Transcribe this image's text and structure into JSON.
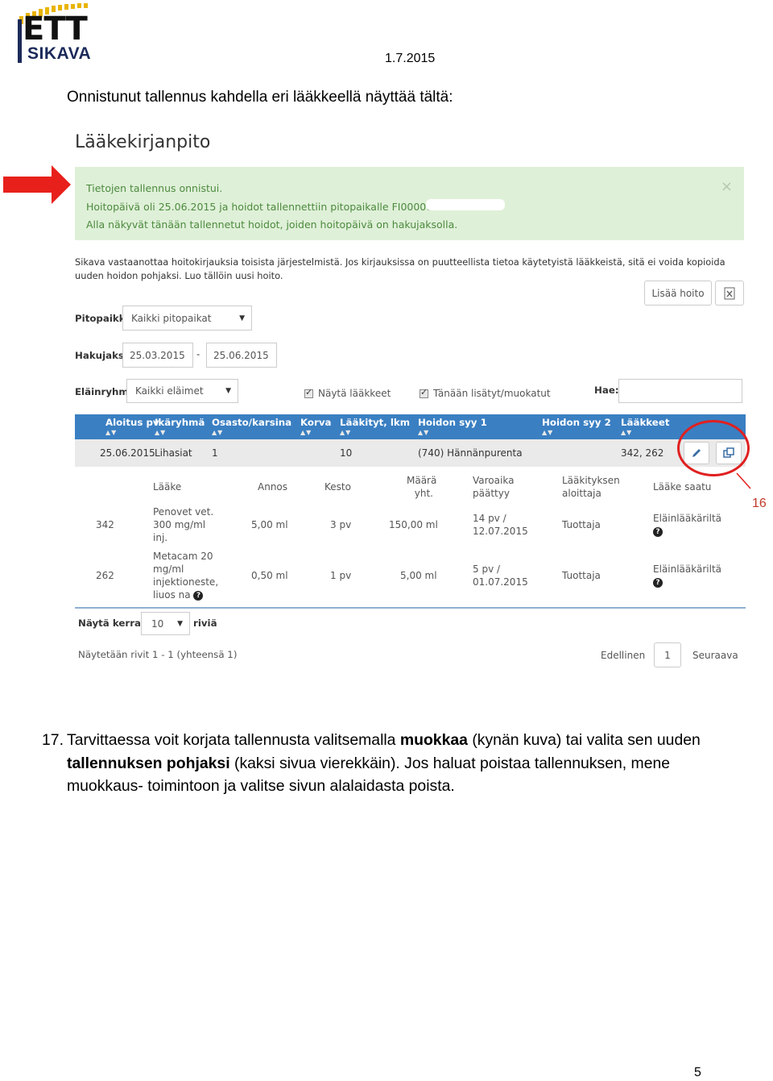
{
  "header": {
    "logo_text_top": "ETT",
    "logo_text_bottom": "SIKAVA",
    "date": "1.7.2015"
  },
  "intro": "Onnistunut tallennus kahdella eri lääkkeellä näyttää tältä:",
  "app": {
    "title": "Lääkekirjanpito",
    "alert": {
      "line1": "Tietojen tallennus onnistui.",
      "line2": "Hoitopäivä oli 25.06.2015 ja hoidot tallennettiin pitopaikalle FI00000",
      "line3": "Alla näkyvät tänään tallennetut hoidot, joiden hoitopäivä on hakujaksolla.",
      "close": "×"
    },
    "info": "Sikava vastaanottaa hoitokirjauksia toisista järjestelmistä. Jos kirjauksissa on puutteellista tietoa käytetyistä lääkkeistä, sitä ei voida kopioida uuden hoidon pohjaksi. Luo tällöin uusi hoito.",
    "add_button": "Lisää hoito",
    "filters": {
      "pitopaikka_label": "Pitopaikka",
      "pitopaikka_value": "Kaikki pitopaikat",
      "hakujakso_label": "Hakujakso",
      "date_from": "25.03.2015",
      "date_sep": "-",
      "date_to": "25.06.2015",
      "elainryhma_label": "Eläinryhmä",
      "elainryhma_value": "Kaikki eläimet",
      "check1": "Näytä lääkkeet",
      "check2": "Tänään lisätyt/muokatut",
      "search_label": "Hae:"
    },
    "table": {
      "headers": [
        "Aloitus pv",
        "Ikäryhmä",
        "Osasto/karsina",
        "Korva",
        "Lääkityt, lkm",
        "Hoidon syy 1",
        "Hoidon syy 2",
        "Lääkkeet"
      ],
      "sort_glyph": "▲▼",
      "row": {
        "aloitus": "25.06.2015",
        "ikaryhma": "Lihasiat",
        "osasto": "1",
        "laakityt": "10",
        "syy1": "(740) Hännänpurenta",
        "laakkeet": "342, 262"
      },
      "sub_headers": {
        "laake": "Lääke",
        "annos": "Annos",
        "kesto": "Kesto",
        "maara_1": "Määrä",
        "maara_2": "yht.",
        "varoaika_1": "Varoaika",
        "varoaika_2": "päättyy",
        "aloittaja_1": "Lääkityksen",
        "aloittaja_2": "aloittaja",
        "saatu": "Lääke saatu"
      },
      "sub_rows": [
        {
          "id": "342",
          "laake": [
            "Penovet vet.",
            "300 mg/ml",
            "inj."
          ],
          "annos": "5,00 ml",
          "kesto": "3 pv",
          "maara": "150,00 ml",
          "varoaika": [
            "14 pv /",
            "12.07.2015"
          ],
          "aloittaja": "Tuottaja",
          "saatu": "Eläinlääkäriltä"
        },
        {
          "id": "262",
          "laake": [
            "Metacam 20",
            "mg/ml",
            "injektioneste,",
            "liuos na"
          ],
          "annos": "0,50 ml",
          "kesto": "1 pv",
          "maara": "5,00 ml",
          "varoaika": [
            "5 pv /",
            "01.07.2015"
          ],
          "aloittaja": "Tuottaja",
          "saatu": "Eläinlääkäriltä"
        }
      ]
    },
    "footer": {
      "show_label": "Näytä kerralla",
      "page_size": "10",
      "rows_label": "riviä",
      "summary": "Näytetään rivit 1 - 1 (yhteensä 1)",
      "prev": "Edellinen",
      "page": "1",
      "next": "Seuraava"
    }
  },
  "callout": "16",
  "step": {
    "number": "17.",
    "text_a": "Tarvittaessa voit korjata tallennusta valitsemalla ",
    "bold_a": "muokkaa",
    "text_b": " (kynän kuva) tai valita sen uuden ",
    "bold_b": "tallennuksen pohjaksi",
    "text_c": " (kaksi sivua vierekkäin). Jos haluat poistaa tallennuksen, mene muokkaus- toimintoon ja valitse sivun alalaidasta poista."
  },
  "page_number": "5",
  "colors": {
    "table_header": "#3a7fc2",
    "alert_bg": "#dff0d8",
    "highlight": "#e02020"
  }
}
